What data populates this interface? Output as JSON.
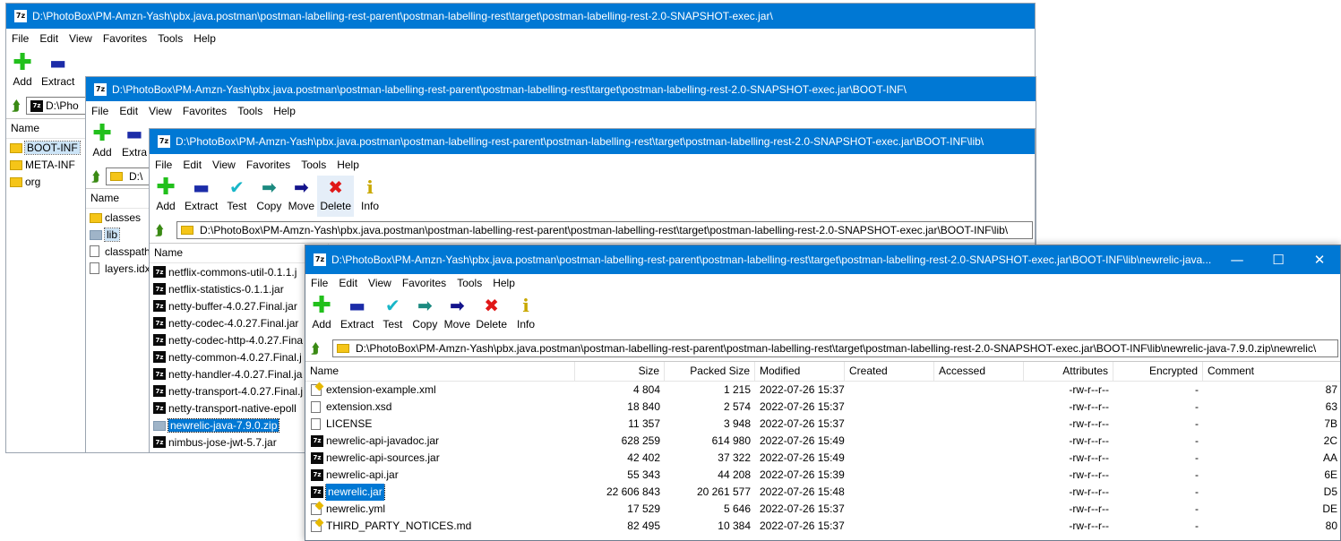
{
  "win1": {
    "title": "D:\\PhotoBox\\PM-Amzn-Yash\\pbx.java.postman\\postman-labelling-rest-parent\\postman-labelling-rest\\target\\postman-labelling-rest-2.0-SNAPSHOT-exec.jar\\",
    "menu": [
      "File",
      "Edit",
      "View",
      "Favorites",
      "Tools",
      "Help"
    ],
    "toolbar": [
      "Add",
      "Extract"
    ],
    "address": "D:\\Pho",
    "col_name": "Name",
    "items": [
      "BOOT-INF",
      "META-INF",
      "org"
    ]
  },
  "win2": {
    "title": "D:\\PhotoBox\\PM-Amzn-Yash\\pbx.java.postman\\postman-labelling-rest-parent\\postman-labelling-rest\\target\\postman-labelling-rest-2.0-SNAPSHOT-exec.jar\\BOOT-INF\\",
    "menu": [
      "File",
      "Edit",
      "View",
      "Favorites",
      "Tools",
      "Help"
    ],
    "toolbar": [
      "Add",
      "Extra"
    ],
    "address": "D:\\",
    "col_name": "Name",
    "items": [
      "classes",
      "lib",
      "classpath",
      "layers.idx"
    ]
  },
  "win3": {
    "title": "D:\\PhotoBox\\PM-Amzn-Yash\\pbx.java.postman\\postman-labelling-rest-parent\\postman-labelling-rest\\target\\postman-labelling-rest-2.0-SNAPSHOT-exec.jar\\BOOT-INF\\lib\\",
    "menu": [
      "File",
      "Edit",
      "View",
      "Favorites",
      "Tools",
      "Help"
    ],
    "toolbar": [
      "Add",
      "Extract",
      "Test",
      "Copy",
      "Move",
      "Delete",
      "Info"
    ],
    "address": "D:\\PhotoBox\\PM-Amzn-Yash\\pbx.java.postman\\postman-labelling-rest-parent\\postman-labelling-rest\\target\\postman-labelling-rest-2.0-SNAPSHOT-exec.jar\\BOOT-INF\\lib\\",
    "col_name": "Name",
    "items": [
      "netflix-commons-util-0.1.1.j",
      "netflix-statistics-0.1.1.jar",
      "netty-buffer-4.0.27.Final.jar",
      "netty-codec-4.0.27.Final.jar",
      "netty-codec-http-4.0.27.Fina",
      "netty-common-4.0.27.Final.j",
      "netty-handler-4.0.27.Final.ja",
      "netty-transport-4.0.27.Final.j",
      "netty-transport-native-epoll",
      "newrelic-java-7.9.0.zip",
      "nimbus-jose-jwt-5.7.jar"
    ]
  },
  "win4": {
    "title": "D:\\PhotoBox\\PM-Amzn-Yash\\pbx.java.postman\\postman-labelling-rest-parent\\postman-labelling-rest\\target\\postman-labelling-rest-2.0-SNAPSHOT-exec.jar\\BOOT-INF\\lib\\newrelic-java...",
    "controls": {
      "minimize": "—",
      "maximize": "☐",
      "close": "✕"
    },
    "menu": [
      "File",
      "Edit",
      "View",
      "Favorites",
      "Tools",
      "Help"
    ],
    "toolbar": [
      "Add",
      "Extract",
      "Test",
      "Copy",
      "Move",
      "Delete",
      "Info"
    ],
    "address": "D:\\PhotoBox\\PM-Amzn-Yash\\pbx.java.postman\\postman-labelling-rest-parent\\postman-labelling-rest\\target\\postman-labelling-rest-2.0-SNAPSHOT-exec.jar\\BOOT-INF\\lib\\newrelic-java-7.9.0.zip\\newrelic\\",
    "columns": [
      "Name",
      "Size",
      "Packed Size",
      "Modified",
      "Created",
      "Accessed",
      "Attributes",
      "Encrypted",
      "Comment"
    ],
    "rows": [
      {
        "name": "extension-example.xml",
        "icon": "xml-file-icon",
        "size": "4 804",
        "packed": "1 215",
        "modified": "2022-07-26 15:37",
        "created": "",
        "accessed": "",
        "attributes": "-rw-r--r--",
        "encrypted": "-",
        "crc": "87"
      },
      {
        "name": "extension.xsd",
        "icon": "document-icon",
        "size": "18 840",
        "packed": "2 574",
        "modified": "2022-07-26 15:37",
        "created": "",
        "accessed": "",
        "attributes": "-rw-r--r--",
        "encrypted": "-",
        "crc": "63"
      },
      {
        "name": "LICENSE",
        "icon": "document-icon",
        "size": "11 357",
        "packed": "3 948",
        "modified": "2022-07-26 15:37",
        "created": "",
        "accessed": "",
        "attributes": "-rw-r--r--",
        "encrypted": "-",
        "crc": "7B"
      },
      {
        "name": "newrelic-api-javadoc.jar",
        "icon": "archive-icon",
        "size": "628 259",
        "packed": "614 980",
        "modified": "2022-07-26 15:49",
        "created": "",
        "accessed": "",
        "attributes": "-rw-r--r--",
        "encrypted": "-",
        "crc": "2C"
      },
      {
        "name": "newrelic-api-sources.jar",
        "icon": "archive-icon",
        "size": "42 402",
        "packed": "37 322",
        "modified": "2022-07-26 15:49",
        "created": "",
        "accessed": "",
        "attributes": "-rw-r--r--",
        "encrypted": "-",
        "crc": "AA"
      },
      {
        "name": "newrelic-api.jar",
        "icon": "archive-icon",
        "size": "55 343",
        "packed": "44 208",
        "modified": "2022-07-26 15:39",
        "created": "",
        "accessed": "",
        "attributes": "-rw-r--r--",
        "encrypted": "-",
        "crc": "6E"
      },
      {
        "name": "newrelic.jar",
        "icon": "archive-icon",
        "size": "22 606 843",
        "packed": "20 261 577",
        "modified": "2022-07-26 15:48",
        "created": "",
        "accessed": "",
        "attributes": "-rw-r--r--",
        "encrypted": "-",
        "crc": "D5"
      },
      {
        "name": "newrelic.yml",
        "icon": "xml-file-icon",
        "size": "17 529",
        "packed": "5 646",
        "modified": "2022-07-26 15:37",
        "created": "",
        "accessed": "",
        "attributes": "-rw-r--r--",
        "encrypted": "-",
        "crc": "DE"
      },
      {
        "name": "THIRD_PARTY_NOTICES.md",
        "icon": "xml-file-icon",
        "size": "82 495",
        "packed": "10 384",
        "modified": "2022-07-26 15:37",
        "created": "",
        "accessed": "",
        "attributes": "-rw-r--r--",
        "encrypted": "-",
        "crc": "80"
      }
    ]
  },
  "app_icon_text": "7z",
  "up_icon": "⮭",
  "colors": {
    "titlebar": "#0078d4",
    "selection": "#0078d4"
  }
}
